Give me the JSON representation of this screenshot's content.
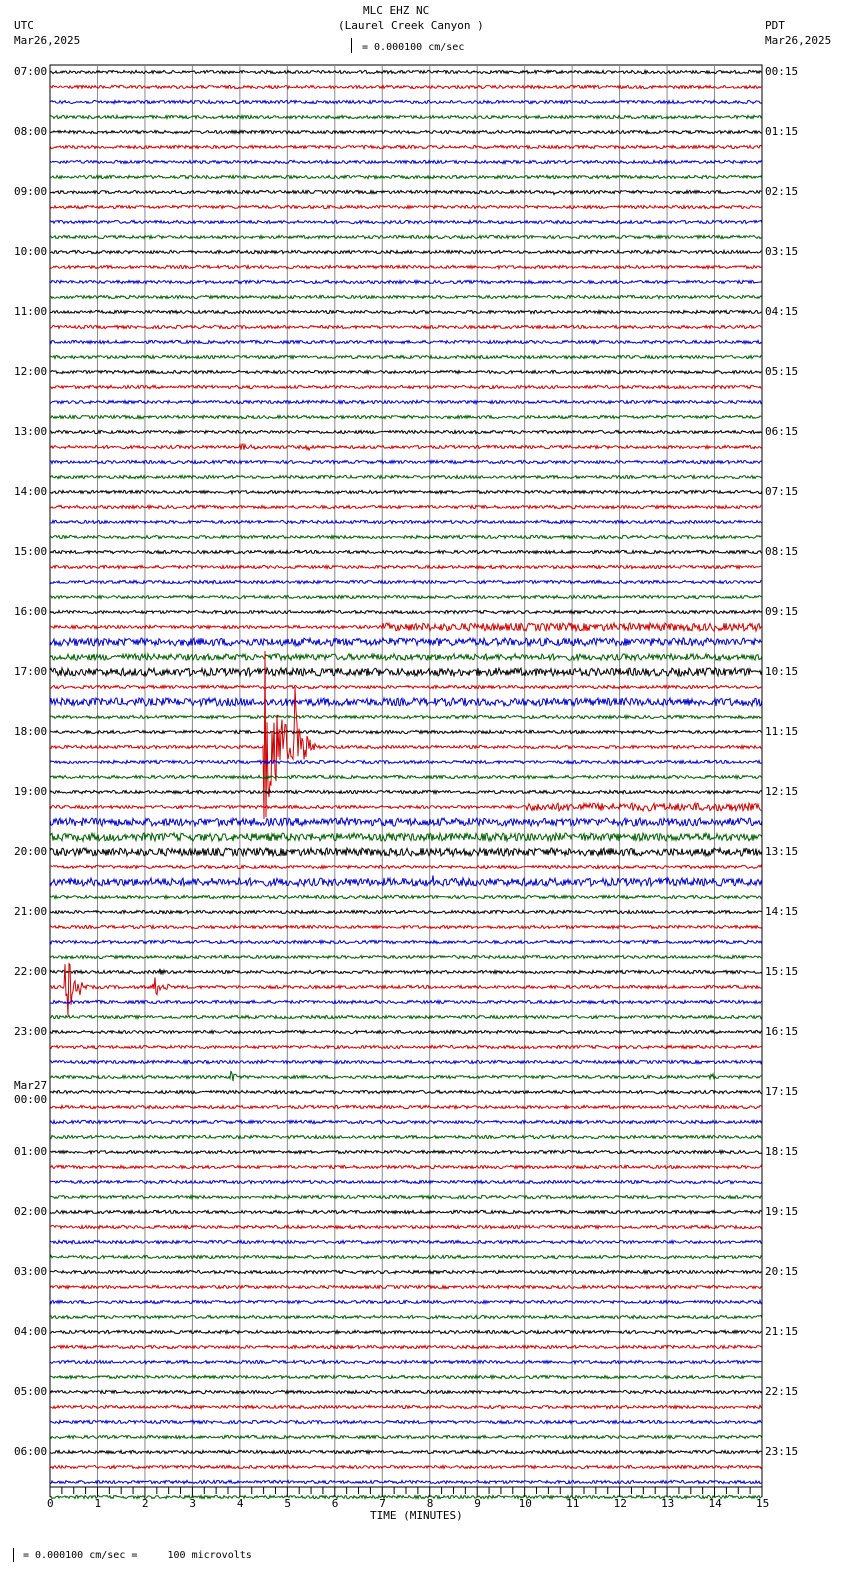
{
  "header": {
    "station": "MLC EHZ NC",
    "location": "(Laurel Creek Canyon )",
    "left_tz": "UTC",
    "left_date": "Mar26,2025",
    "right_tz": "PDT",
    "right_date": "Mar26,2025",
    "scale": "= 0.000100 cm/sec"
  },
  "footer": {
    "scale": "= 0.000100 cm/sec =     100 microvolts"
  },
  "chart_data": {
    "type": "line",
    "title": "MLC EHZ NC (Laurel Creek Canyon )",
    "xlabel": "TIME (MINUTES)",
    "xlim": [
      0,
      15
    ],
    "x_ticks": [
      "0",
      "1",
      "2",
      "3",
      "4",
      "5",
      "6",
      "7",
      "8",
      "9",
      "10",
      "11",
      "12",
      "13",
      "14",
      "15"
    ],
    "traces_per_hour": 4,
    "trace_colors": [
      "#000000",
      "#d00000",
      "#0000d0",
      "#006000"
    ],
    "left_labels": [
      "07:00",
      "08:00",
      "09:00",
      "10:00",
      "11:00",
      "12:00",
      "13:00",
      "14:00",
      "15:00",
      "16:00",
      "17:00",
      "18:00",
      "19:00",
      "20:00",
      "21:00",
      "22:00",
      "23:00",
      "00:00",
      "01:00",
      "02:00",
      "03:00",
      "04:00",
      "05:00",
      "06:00"
    ],
    "date_change_label": "Mar27",
    "right_labels": [
      "00:15",
      "01:15",
      "02:15",
      "03:15",
      "04:15",
      "05:15",
      "06:15",
      "07:15",
      "08:15",
      "09:15",
      "10:15",
      "11:15",
      "12:15",
      "13:15",
      "14:15",
      "15:15",
      "16:15",
      "17:15",
      "18:15",
      "19:15",
      "20:15",
      "21:15",
      "22:15",
      "23:15"
    ],
    "noisy_traces": [
      {
        "trace": 37,
        "from": 7,
        "to": 15,
        "amp": 2.5
      },
      {
        "trace": 38,
        "from": 0,
        "to": 15,
        "amp": 2.5
      },
      {
        "trace": 39,
        "from": 0,
        "to": 15,
        "amp": 2
      },
      {
        "trace": 40,
        "from": 0,
        "to": 15,
        "amp": 2.5
      },
      {
        "trace": 42,
        "from": 0,
        "to": 15,
        "amp": 2.5
      },
      {
        "trace": 49,
        "from": 10,
        "to": 15,
        "amp": 2.5
      },
      {
        "trace": 50,
        "from": 0,
        "to": 15,
        "amp": 2.5
      },
      {
        "trace": 51,
        "from": 0,
        "to": 15,
        "amp": 2.5
      },
      {
        "trace": 52,
        "from": 0,
        "to": 15,
        "amp": 2.5
      },
      {
        "trace": 54,
        "from": 0,
        "to": 15,
        "amp": 2.5
      }
    ],
    "events": [
      {
        "trace": 8,
        "minute": 10.6,
        "amp": 7,
        "dur": 0.1
      },
      {
        "trace": 25,
        "minute": 4.0,
        "amp": 4,
        "dur": 0.6
      },
      {
        "trace": 25,
        "minute": 5.4,
        "amp": 5,
        "dur": 0.2
      },
      {
        "trace": 43,
        "minute": 10.6,
        "amp": 6,
        "dur": 0.15
      },
      {
        "trace": 45,
        "minute": 4.5,
        "amp": 110,
        "dur": 0.9
      },
      {
        "trace": 45,
        "minute": 5.15,
        "amp": 60,
        "dur": 0.5
      },
      {
        "trace": 54,
        "minute": 8.05,
        "amp": 12,
        "dur": 0.2
      },
      {
        "trace": 61,
        "minute": 0.3,
        "amp": 50,
        "dur": 0.5
      },
      {
        "trace": 61,
        "minute": 2.15,
        "amp": 14,
        "dur": 0.6
      },
      {
        "trace": 60,
        "minute": 2.3,
        "amp": 6,
        "dur": 0.2
      },
      {
        "trace": 67,
        "minute": 3.8,
        "amp": 10,
        "dur": 0.2
      },
      {
        "trace": 67,
        "minute": 13.9,
        "amp": 6,
        "dur": 0.3
      }
    ]
  }
}
